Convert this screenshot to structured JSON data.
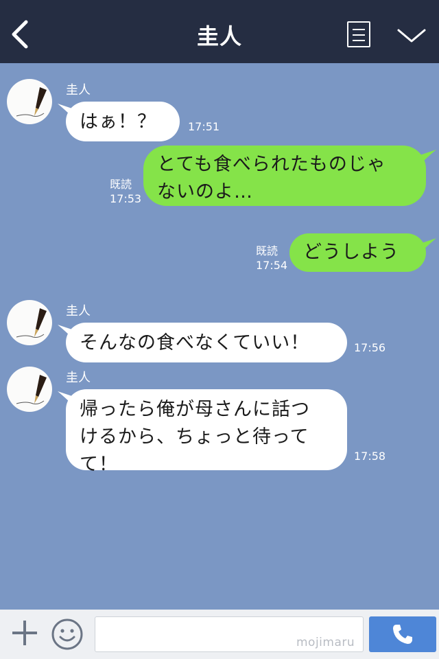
{
  "header": {
    "title": "圭人"
  },
  "messages": [
    {
      "side": "left",
      "sender": "圭人",
      "text": "はぁ！？",
      "time": "17:51"
    },
    {
      "side": "right",
      "read": "既読",
      "time": "17:53",
      "lines": [
        "とても食べられたものじゃ",
        "ないのよ…"
      ]
    },
    {
      "side": "right",
      "read": "既読",
      "time": "17:54",
      "text": "どうしよう"
    },
    {
      "side": "left",
      "sender": "圭人",
      "text": "そんなの食べなくていい！",
      "time": "17:56"
    },
    {
      "side": "left",
      "sender": "圭人",
      "time": "17:58",
      "lines": [
        "帰ったら俺が母さんに話つ",
        "けるから、ちょっと待って",
        "て！"
      ]
    }
  ],
  "input": {
    "value": "",
    "watermark": "mojimaru"
  },
  "colors": {
    "header_bg": "#252d42",
    "chat_bg": "#7b97c4",
    "sent_bubble": "#85e349",
    "received_bubble": "#ffffff",
    "call_button": "#4e86d7"
  },
  "icons": [
    "back-icon",
    "menu-icon",
    "chevron-down-icon",
    "plus-icon",
    "smiley-icon",
    "phone-icon"
  ]
}
